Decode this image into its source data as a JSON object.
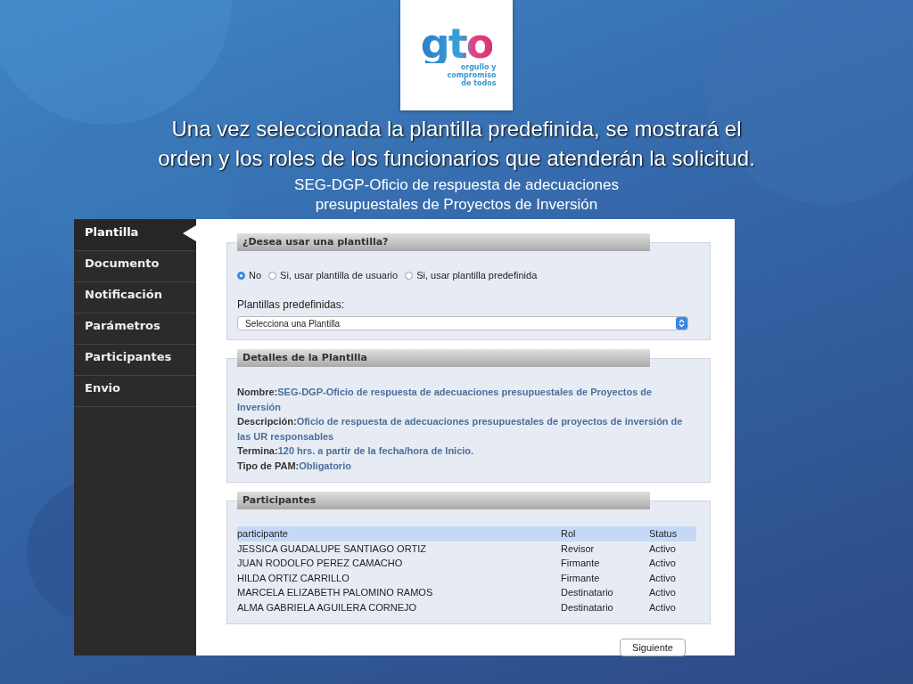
{
  "logo": {
    "wordmark": "gto",
    "tagline": [
      "orgullo y",
      "compromiso",
      "de todos"
    ]
  },
  "heading_lines": [
    "Una vez seleccionada la plantilla predefinida, se mostrará el",
    "orden y los roles de los funcionarios que atenderán la solicitud."
  ],
  "subheading_lines": [
    "SEG-DGP-Oficio de respuesta de adecuaciones",
    "presupuestales de Proyectos de Inversión"
  ],
  "sidebar": {
    "items": [
      {
        "label": "Plantilla",
        "selected": true
      },
      {
        "label": "Documento",
        "selected": false
      },
      {
        "label": "Notificación",
        "selected": false
      },
      {
        "label": "Parámetros",
        "selected": false
      },
      {
        "label": "Participantes",
        "selected": false
      },
      {
        "label": "Envio",
        "selected": false
      }
    ]
  },
  "template_panel": {
    "title": "¿Desea usar una plantilla?",
    "radios": [
      {
        "label": "No",
        "selected": true
      },
      {
        "label": "Si, usar plantilla de usuario",
        "selected": false
      },
      {
        "label": "Si, usar plantilla predefinida",
        "selected": false
      }
    ],
    "select_label": "Plantillas predefinidas:",
    "select_value": "Selecciona una Plantilla"
  },
  "details_panel": {
    "title": "Detalles de la Plantilla",
    "fields": [
      {
        "label": "Nombre:",
        "value": "SEG-DGP-Oficio de respuesta de adecuaciones presupuestales de Proyectos de Inversión"
      },
      {
        "label": "Descripción:",
        "value": "Oficio de respuesta de adecuaciones presupuestales de proyectos de inversión de las UR responsables"
      },
      {
        "label": "Termina:",
        "value": "120 hrs. a partir de la fecha/hora de Inicio."
      },
      {
        "label": "Tipo de PAM:",
        "value": "Obligatorio"
      }
    ]
  },
  "participants_panel": {
    "title": "Participantes",
    "columns": [
      "participante",
      "Rol",
      "Status"
    ],
    "rows": [
      [
        "JESSICA GUADALUPE SANTIAGO ORTIZ",
        "Revisor",
        "Activo"
      ],
      [
        "JUAN RODOLFO PEREZ CAMACHO",
        "Firmante",
        "Activo"
      ],
      [
        "HILDA ORTIZ CARRILLO",
        "Firmante",
        "Activo"
      ],
      [
        "MARCELA ELIZABETH PALOMINO RAMOS",
        "Destinatario",
        "Activo"
      ],
      [
        "ALMA GABRIELA AGUILERA CORNEJO",
        "Destinatario",
        "Activo"
      ]
    ]
  },
  "next_button": "Siguiente"
}
